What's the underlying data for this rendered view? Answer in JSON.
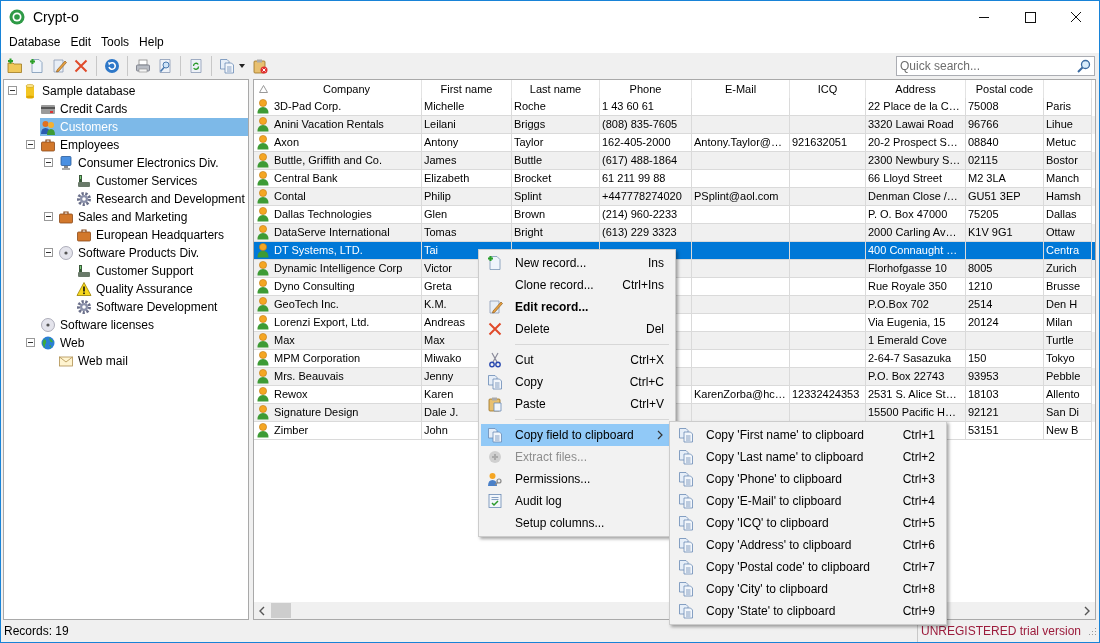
{
  "window": {
    "title": "Crypt-o"
  },
  "menu_bar": [
    "Database",
    "Edit",
    "Tools",
    "Help"
  ],
  "toolbar": [
    {
      "kind": "folder-add"
    },
    {
      "kind": "doc-add"
    },
    {
      "kind": "edit"
    },
    {
      "kind": "delete"
    },
    {
      "kind": "separator"
    },
    {
      "kind": "undo"
    },
    {
      "kind": "separator"
    },
    {
      "kind": "print"
    },
    {
      "kind": "preview"
    },
    {
      "kind": "separator"
    },
    {
      "kind": "refresh"
    },
    {
      "kind": "separator"
    },
    {
      "kind": "copy"
    },
    {
      "kind": "dropdown"
    },
    {
      "kind": "clipboard-delete"
    }
  ],
  "search": {
    "placeholder": "Quick search..."
  },
  "tree": [
    {
      "label": "Sample database",
      "kind": "database",
      "expanded": true,
      "selected": false,
      "children": [
        {
          "label": "Credit Cards",
          "kind": "cards",
          "selected": false
        },
        {
          "label": "Customers",
          "kind": "people",
          "selected": true
        },
        {
          "label": "Employees",
          "kind": "briefcase",
          "expanded": true,
          "selected": false,
          "children": [
            {
              "label": "Consumer Electronics Div.",
              "kind": "computer",
              "expanded": true,
              "selected": false,
              "children": [
                {
                  "label": "Customer Services",
                  "kind": "phone",
                  "selected": false
                },
                {
                  "label": "Research and Development",
                  "kind": "gear",
                  "selected": false
                }
              ]
            },
            {
              "label": "Sales and Marketing",
              "kind": "briefcase",
              "expanded": true,
              "selected": false,
              "children": [
                {
                  "label": "European Headquarters",
                  "kind": "briefcase",
                  "selected": false
                }
              ]
            },
            {
              "label": "Software Products Div.",
              "kind": "disc",
              "expanded": true,
              "selected": false,
              "children": [
                {
                  "label": "Customer Support",
                  "kind": "phone",
                  "selected": false
                },
                {
                  "label": "Quality Assurance",
                  "kind": "warning",
                  "selected": false
                },
                {
                  "label": "Software Development",
                  "kind": "gear",
                  "selected": false
                }
              ]
            }
          ]
        },
        {
          "label": "Software licenses",
          "kind": "disc",
          "selected": false
        },
        {
          "label": "Web",
          "kind": "globe",
          "expanded": true,
          "selected": false,
          "children": [
            {
              "label": "Web mail",
              "kind": "mail",
              "selected": false
            }
          ]
        }
      ]
    }
  ],
  "table": {
    "sort_ascending": true,
    "columns": [
      "Company",
      "First name",
      "Last name",
      "Phone",
      "E-Mail",
      "ICQ",
      "Address",
      "Postal code"
    ],
    "rows": [
      {
        "company": "3D-Pad Corp.",
        "first_name": "Michelle",
        "last_name": "Roche",
        "phone": "1 43 60 61",
        "address": "22 Place de la C…",
        "postal_code": "75008",
        "column_9": "Paris",
        "selected": false
      },
      {
        "company": "Anini Vacation Rentals",
        "first_name": "Leilani",
        "last_name": "Briggs",
        "phone": "(808) 835-7605",
        "address": "3320 Lawai Road",
        "postal_code": "96766",
        "column_9": "Lihue",
        "selected": false
      },
      {
        "company": "Axon",
        "first_name": "Antony",
        "last_name": "Taylor",
        "phone": "162-405-2000",
        "email": "Antony.Taylor@…",
        "icq": "921632051",
        "address": "20-2 Prospect S…",
        "postal_code": "08840",
        "column_9": "Metuc",
        "selected": false
      },
      {
        "company": "Buttle, Griffith and Co.",
        "first_name": "James",
        "last_name": "Buttle",
        "phone": "(617) 488-1864",
        "address": "2300 Newbury S…",
        "postal_code": "02115",
        "column_9": "Bostor",
        "selected": false
      },
      {
        "company": "Central Bank",
        "first_name": "Elizabeth",
        "last_name": "Brocket",
        "phone": "61 211 99 88",
        "address": "66 Lloyd Street",
        "postal_code": "M2 3LA",
        "column_9": "Manch",
        "selected": false
      },
      {
        "company": "Contal",
        "first_name": "Philip",
        "last_name": "Splint",
        "phone": "+447778274020",
        "email": "PSplint@aol.com",
        "address": "Denman Close /…",
        "postal_code": "GU51 3EP",
        "column_9": "Hamsh",
        "selected": false
      },
      {
        "company": "Dallas Technologies",
        "first_name": "Glen",
        "last_name": "Brown",
        "phone": "(214) 960-2233",
        "address": "P. O. Box 47000",
        "postal_code": "75205",
        "column_9": "Dallas",
        "selected": false
      },
      {
        "company": "DataServe International",
        "first_name": "Tomas",
        "last_name": "Bright",
        "phone": "(613) 229 3323",
        "address": "2000 Carling Av…",
        "postal_code": "K1V 9G1",
        "column_9": "Ottaw",
        "selected": false
      },
      {
        "company": "DT Systems, LTD.",
        "first_name": "Tai",
        "address": "400 Connaught …",
        "column_9": "Centra",
        "selected": true
      },
      {
        "company": "Dynamic Intelligence Corp",
        "first_name": "Victor",
        "address": "Florhofgasse 10",
        "postal_code": "8005",
        "column_9": "Zurich",
        "selected": false
      },
      {
        "company": "Dyno Consulting",
        "first_name": "Greta",
        "address": "Rue Royale 350",
        "postal_code": "1210",
        "column_9": "Brusse",
        "selected": false
      },
      {
        "company": "GeoTech Inc.",
        "first_name": "K.M.",
        "address": "P.O.Box 702",
        "postal_code": "2514",
        "column_9": "Den H",
        "selected": false
      },
      {
        "company": "Lorenzi Export, Ltd.",
        "first_name": "Andreas",
        "address": "Via Eugenia, 15",
        "postal_code": "20124",
        "column_9": "Milan",
        "selected": false
      },
      {
        "company": "Max",
        "first_name": "Max",
        "address": "1 Emerald Cove",
        "column_9": "Turtle",
        "selected": false
      },
      {
        "company": "MPM Corporation",
        "first_name": "Miwako",
        "address": "2-64-7 Sasazuka",
        "postal_code": "150",
        "column_9": "Tokyo",
        "selected": false
      },
      {
        "company": "Mrs. Beauvais",
        "first_name": "Jenny",
        "address": "P.O. Box 22743",
        "postal_code": "93953",
        "column_9": "Pebble",
        "selected": false
      },
      {
        "company": "Rewox",
        "first_name": "Karen",
        "email": "KarenZorba@hc…",
        "icq": "12332424353",
        "address": "2531 S. Alice St…",
        "postal_code": "18103",
        "column_9": "Allento",
        "selected": false
      },
      {
        "company": "Signature Design",
        "first_name": "Dale J.",
        "address": "15500 Pacific H…",
        "postal_code": "92121",
        "column_9": "San Di",
        "selected": false
      },
      {
        "company": "Zimber",
        "first_name": "John",
        "postal_code": "53151",
        "column_9": "New B",
        "selected": false
      }
    ]
  },
  "context_menu": {
    "groups": [
      [
        {
          "label": "New record...",
          "shortcut": "Ins",
          "kind": "doc-add",
          "selected": false,
          "disabled": false
        },
        {
          "label": "Clone record...",
          "shortcut": "Ctrl+Ins",
          "kind": "none",
          "selected": false,
          "disabled": false
        },
        {
          "label": "Edit record...",
          "kind": "edit",
          "bold": true,
          "selected": false,
          "disabled": false
        },
        {
          "label": "Delete",
          "shortcut": "Del",
          "kind": "delete",
          "selected": false,
          "disabled": false
        }
      ],
      [
        {
          "label": "Cut",
          "shortcut": "Ctrl+X",
          "kind": "cut",
          "selected": false,
          "disabled": false
        },
        {
          "label": "Copy",
          "shortcut": "Ctrl+C",
          "kind": "copy",
          "selected": false,
          "disabled": false
        },
        {
          "label": "Paste",
          "shortcut": "Ctrl+V",
          "kind": "paste",
          "selected": false,
          "disabled": false
        }
      ],
      [
        {
          "label": "Copy field to clipboard",
          "kind": "copy",
          "submenu": true,
          "selected": true,
          "disabled": false
        },
        {
          "label": "Extract files...",
          "kind": "extract",
          "selected": false,
          "disabled": true
        },
        {
          "label": "Permissions...",
          "kind": "permissions",
          "selected": false,
          "disabled": false
        },
        {
          "label": "Audit log",
          "kind": "audit",
          "selected": false,
          "disabled": false
        },
        {
          "label": "Setup columns...",
          "kind": "none",
          "selected": false,
          "disabled": false
        }
      ]
    ],
    "submenu": [
      {
        "label": "Copy 'First name' to clipboard",
        "shortcut": "Ctrl+1"
      },
      {
        "label": "Copy 'Last name' to clipboard",
        "shortcut": "Ctrl+2"
      },
      {
        "label": "Copy 'Phone' to clipboard",
        "shortcut": "Ctrl+3"
      },
      {
        "label": "Copy 'E-Mail' to clipboard",
        "shortcut": "Ctrl+4"
      },
      {
        "label": "Copy 'ICQ' to clipboard",
        "shortcut": "Ctrl+5"
      },
      {
        "label": "Copy 'Address' to clipboard",
        "shortcut": "Ctrl+6"
      },
      {
        "label": "Copy 'Postal code' to clipboard",
        "shortcut": "Ctrl+7"
      },
      {
        "label": "Copy 'City' to clipboard",
        "shortcut": "Ctrl+8"
      },
      {
        "label": "Copy 'State' to clipboard",
        "shortcut": "Ctrl+9"
      }
    ]
  },
  "status_bar": {
    "records": "Records: 19",
    "notice": "UNREGISTERED trial version"
  }
}
